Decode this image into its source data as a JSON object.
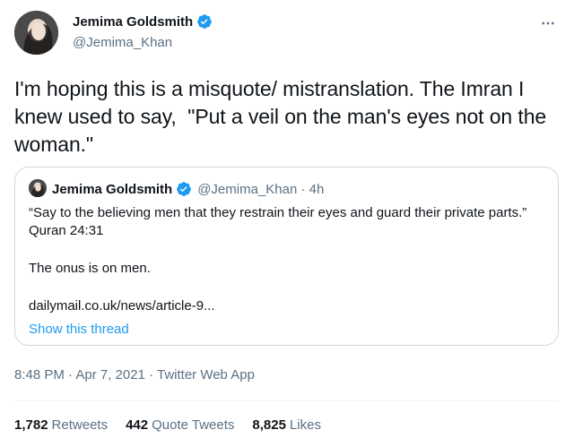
{
  "author": {
    "name": "Jemima Goldsmith",
    "handle": "@Jemima_Khan"
  },
  "tweet": {
    "text": "I'm hoping this is a misquote/ mistranslation. The Imran I knew used to say,  \"Put a veil on the man's eyes not on the woman.\""
  },
  "quote": {
    "name": "Jemima Goldsmith",
    "meta": "@Jemima_Khan · 4h",
    "paragraph1": "“Say to the believing men that they restrain their eyes and guard their private parts.” Quran 24:31",
    "paragraph2": "The onus is on men.",
    "link": "dailymail.co.uk/news/article-9...",
    "show_thread": "Show this thread"
  },
  "timestamp": "8:48 PM · Apr 7, 2021 · Twitter Web App",
  "stats": [
    {
      "count": "1,782",
      "label": "Retweets"
    },
    {
      "count": "442",
      "label": "Quote Tweets"
    },
    {
      "count": "8,825",
      "label": "Likes"
    }
  ],
  "colors": {
    "accent": "#1d9bf0",
    "secondary_text": "#5b7083",
    "border": "#cfd9de"
  },
  "icons": [
    "avatar-photo",
    "verified-badge-icon",
    "more-icon"
  ]
}
